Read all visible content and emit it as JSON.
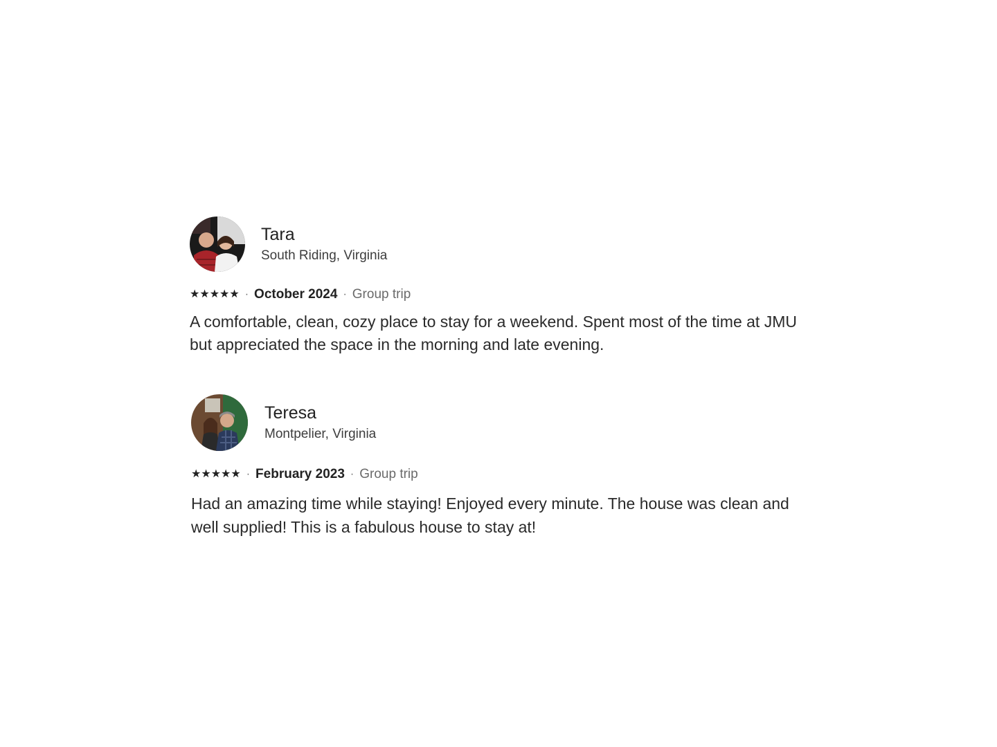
{
  "reviews": [
    {
      "name": "Tara",
      "location": "South Riding, Virginia",
      "rating": 5,
      "stars": "★★★★★",
      "date": "October 2024",
      "trip_type": "Group trip",
      "text": "A comfortable, clean, cozy place to stay for a weekend. Spent most of the time at JMU but appreciated the space in the morning and late evening."
    },
    {
      "name": "Teresa",
      "location": "Montpelier, Virginia",
      "rating": 5,
      "stars": "★★★★★",
      "date": "February 2023",
      "trip_type": "Group trip",
      "text": "Had an amazing time while staying! Enjoyed every minute. The house was clean and well supplied! This is a fabulous house to stay at!"
    }
  ],
  "separator": "·",
  "colors": {
    "text_primary": "#222222",
    "text_secondary": "#6a6a6a",
    "background": "#ffffff"
  }
}
